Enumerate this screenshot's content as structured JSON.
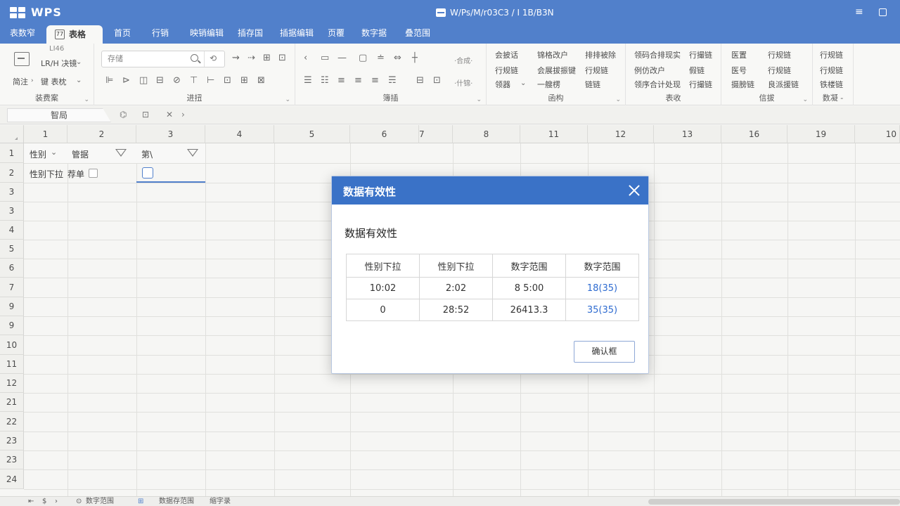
{
  "titlebar": {
    "logo": "WPS",
    "doc_title": "W/Ps/M/r03C3 / I 1B/B3N"
  },
  "menu": {
    "tabs": [
      {
        "label": "表数窄"
      },
      {
        "label": "表格",
        "active": true,
        "icon_text": "77"
      },
      {
        "label": "首页"
      },
      {
        "label": "行销"
      },
      {
        "label": "映销编辑"
      },
      {
        "label": "插存国"
      },
      {
        "label": "插据编辑"
      },
      {
        "label": "页覆"
      },
      {
        "label": "数字据"
      },
      {
        "label": "叠范围"
      }
    ]
  },
  "ribbon": {
    "g1": {
      "top_small": "LI46",
      "mid": "LR/H 决镜",
      "bottom_a": "简注",
      "bottom_b": "键 表枕",
      "label": "装费案"
    },
    "g2": {
      "search_placeholder": "存储",
      "label": "进扭",
      "icon_row1": [
        "⇝",
        "⇢",
        "⊞",
        "⊡"
      ],
      "icon_row2": [
        "⊫",
        "⊳",
        "◫",
        "⊟",
        "⊘",
        "⊤",
        "⊢",
        "⊡",
        "⊞",
        "⊠"
      ]
    },
    "g3": {
      "label": "簿插",
      "hint1": "·合成·",
      "hint2": "·什锦·",
      "icons_row1": [
        "‹",
        "▭",
        "—",
        "▢",
        "≐",
        "⇔",
        "┼"
      ],
      "icons_row2": [
        "☰",
        "☷",
        "≡",
        "≡",
        "≡",
        "☴",
        "⊟",
        "⊡"
      ]
    },
    "g4": {
      "label": "函构",
      "r1": [
        "会披话",
        "锦格改户",
        "排排被除"
      ],
      "r2": [
        "行规链",
        "会展拔振键",
        "行规链"
      ],
      "r3": [
        "领器",
        "一艘楞",
        "链链"
      ]
    },
    "g5": {
      "label": "表收",
      "r1": [
        "领码合排现实",
        "行撮链"
      ],
      "r2": [
        "例仿改户",
        "假链"
      ],
      "r3": [
        "领序合计处现",
        "行撮链"
      ]
    },
    "g6": {
      "label": "信拔",
      "r1": [
        "医置",
        "行规链"
      ],
      "r2": [
        "医号",
        "行规链"
      ],
      "r3": [
        "摄膀链",
        "良派援链"
      ]
    },
    "g7": {
      "label": "数凝 -",
      "r1": "行规链",
      "r2": "行规链",
      "r3": "铁楼链"
    }
  },
  "namebox": "智局",
  "columns": [
    "1",
    "2",
    "3",
    "4",
    "5",
    "6",
    "7",
    "8",
    "11",
    "12",
    "13",
    "16",
    "19",
    "10"
  ],
  "rows": [
    "1",
    "2",
    "3",
    "3",
    "4",
    "5",
    "6",
    "7",
    "9",
    "9",
    "10",
    "11",
    "12",
    "21",
    "22",
    "23",
    "23",
    "24"
  ],
  "cells": {
    "a1": "性别",
    "b1": "管据",
    "c1": "第\\",
    "a2": "性别下拉",
    "b2": "荐单"
  },
  "sheet_tabs": [
    "数字范围",
    "数据存范围",
    "缩字录"
  ],
  "dialog": {
    "title": "数据有效性",
    "subtitle": "数据有效性",
    "headers": [
      "性别下拉",
      "性别下拉",
      "数字范围",
      "数字范围"
    ],
    "rows": [
      [
        "10:02",
        "2:02",
        "8 5:00",
        "18(35)"
      ],
      [
        "0",
        "28:52",
        "26413.3",
        "35(35)"
      ]
    ],
    "ok_button": "确认框"
  }
}
